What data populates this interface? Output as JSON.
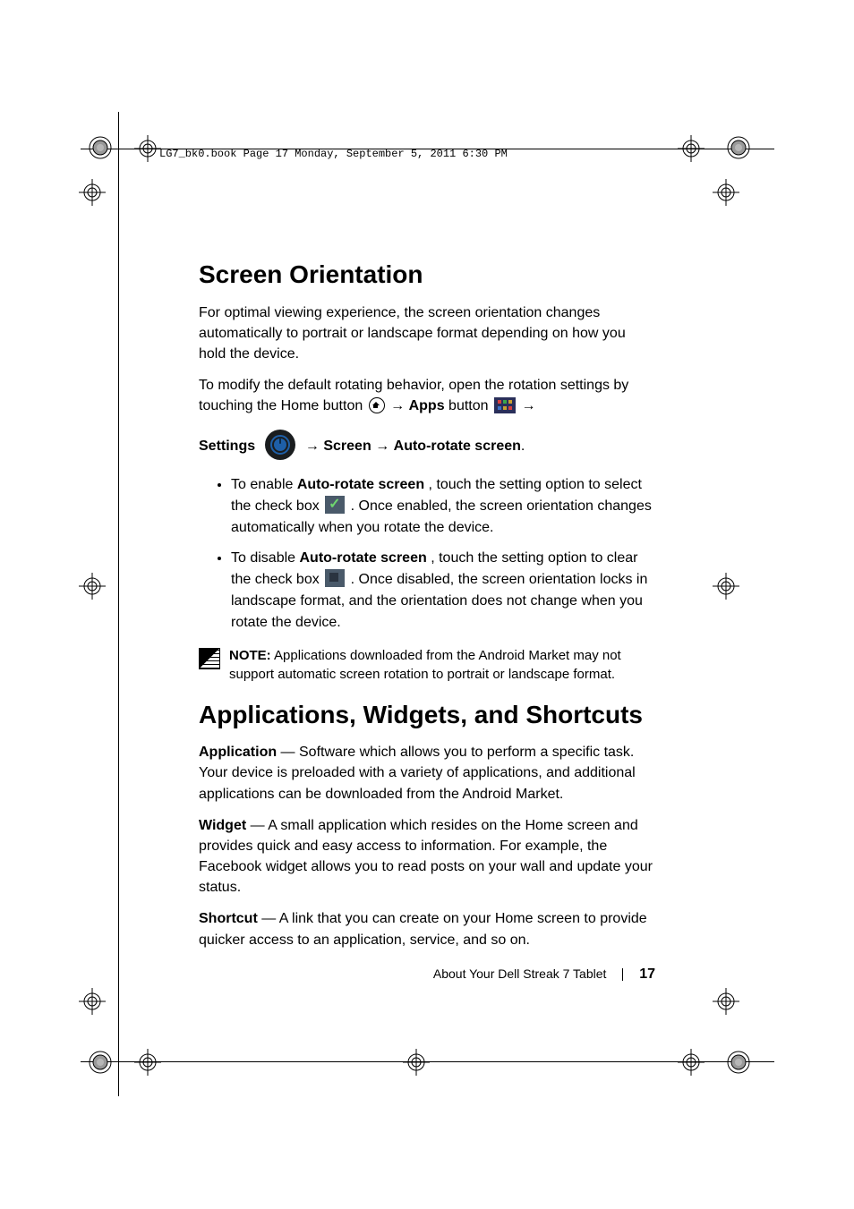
{
  "header": "LG7_bk0.book  Page 17  Monday, September 5, 2011  6:30 PM",
  "section1": {
    "title": "Screen Orientation",
    "p1": "For optimal viewing experience, the screen orientation changes automatically to portrait or landscape format depending on how you hold the device.",
    "p2a": "To modify the default rotating behavior, open the rotation settings by touching the Home button ",
    "p2_apps": "Apps",
    "p2b": " button ",
    "nav_settings": "Settings",
    "nav_screen": "Screen",
    "nav_auto": "Auto-rotate screen",
    "bullet1": {
      "a": "To enable ",
      "bold": "Auto-rotate screen",
      "b": ", touch the setting option to select the check box ",
      "c": ". Once enabled, the screen orientation changes automatically when you rotate the device."
    },
    "bullet2": {
      "a": "To disable ",
      "bold": "Auto-rotate screen",
      "b": ", touch the setting option to clear the check box ",
      "c": ". Once disabled, the screen orientation locks in landscape format, and the orientation does not change when you rotate the device."
    },
    "note_label": "NOTE:",
    "note": " Applications downloaded from the Android Market may not support automatic screen rotation to portrait or landscape format."
  },
  "section2": {
    "title": "Applications, Widgets, and Shortcuts",
    "app_label": "Application",
    "app_text": " — Software which allows you to perform a specific task. Your device is preloaded with a variety of applications, and additional applications can be downloaded from the Android Market.",
    "widget_label": "Widget",
    "widget_text": " — A small application which resides on the Home screen and provides quick and easy access to information. For example, the Facebook widget allows you to read posts on your wall and update your status.",
    "shortcut_label": "Shortcut",
    "shortcut_text": " — A link that you can create on your Home screen to provide quicker access to an application, service, and so on."
  },
  "footer": {
    "text": "About Your Dell Streak 7 Tablet",
    "page": "17"
  }
}
